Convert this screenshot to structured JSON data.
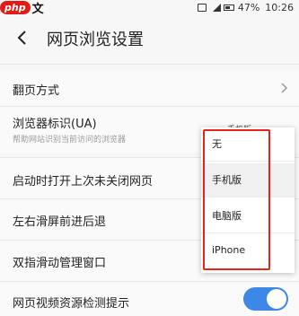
{
  "status_bar": {
    "watermark_badge": "php",
    "watermark_text": "中文网",
    "battery": "47%",
    "time": "10:26"
  },
  "header": {
    "title": "网页浏览设置",
    "back_icon": "chevron-left-icon"
  },
  "settings": {
    "page_turn": {
      "label": "翻页方式"
    },
    "ua": {
      "label": "浏览器标识(UA)",
      "hint": "帮助网站识别当前访问的浏览器",
      "value": "手机版"
    },
    "restore_tabs": {
      "label": "启动时打开上次未关闭网页"
    },
    "swipe_nav": {
      "label": "左右滑屏前进后退"
    },
    "two_finger": {
      "label": "双指滑动管理窗口"
    },
    "video_detect": {
      "label": "网页视频资源检测提示",
      "enabled": true
    }
  },
  "ua_menu": {
    "options": [
      "无",
      "手机版",
      "电脑版",
      "iPhone"
    ],
    "selected": "手机版"
  },
  "colors": {
    "accent": "#3d87e6",
    "highlight_box": "#e8231b"
  }
}
